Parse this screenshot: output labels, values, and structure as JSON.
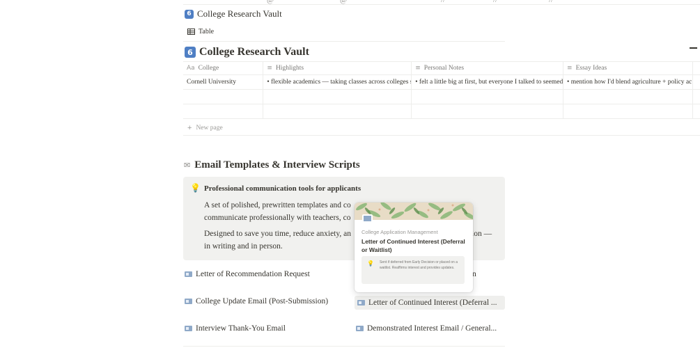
{
  "top_strip": {
    "fragments": [
      "·",
      "@",
      "@",
      "//",
      "//",
      "//"
    ]
  },
  "linked_view": {
    "icon_label": "6",
    "title": "College Research Vault",
    "view_tab": "Table"
  },
  "database": {
    "icon_label": "6",
    "title": "College Research Vault",
    "columns": [
      {
        "icon": "Aa",
        "label": "College"
      },
      {
        "icon": "≡",
        "label": "Highlights"
      },
      {
        "icon": "≡",
        "label": "Personal Notes"
      },
      {
        "icon": "≡",
        "label": "Essay Ideas"
      }
    ],
    "rows": [
      {
        "college": "Cornell University",
        "highlights": "• flexible academics — taking classes across colleges s",
        "notes": "• felt a little big at first, but everyone I talked to seemed",
        "essay": "• mention how I'd blend agriculture + policy ac"
      },
      {
        "college": "",
        "highlights": "",
        "notes": "",
        "essay": ""
      },
      {
        "college": "",
        "highlights": "",
        "notes": "",
        "essay": ""
      }
    ],
    "new_page_label": "New page"
  },
  "section": {
    "icon": "✉",
    "title": "Email Templates & Interview Scripts"
  },
  "callout": {
    "icon": "💡",
    "title": "Professional communication tools for applicants",
    "p1_start": "A set of polished, prewritten templates and co",
    "p1_end": "communicate professionally with teachers, co",
    "p2_start": "Designed to save you time, reduce anxiety, an",
    "p2_end_right": "ion —",
    "p2_line2": "in writing and in person."
  },
  "links": {
    "left": [
      "Letter of Recommendation Request",
      "College Update Email (Post-Submission)",
      "Interview Thank-You Email"
    ],
    "right_partial": "n",
    "right": [
      "Letter of Continued Interest (Deferral ...",
      "Demonstrated Interest Email / General..."
    ]
  },
  "hover_card": {
    "breadcrumb": "College Application Management",
    "title": "Letter of Continued Interest (Deferral or Waitlist)",
    "description": "Sent if deferred from Early Decision or placed on a waitlist. Reaffirms interest and provides updates."
  },
  "colors": {
    "text": "#37352f",
    "muted": "#9b9a97",
    "callout_bg": "#f1f1ef",
    "icon_blue": "#4f7fc4",
    "cover_green": "#8db87a"
  }
}
